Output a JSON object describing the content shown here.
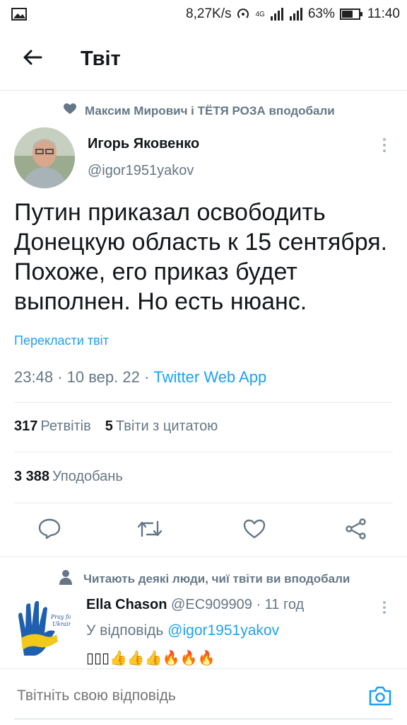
{
  "status_bar": {
    "speed": "8,27K/s",
    "network": "4G",
    "battery": "63%",
    "time": "11:40"
  },
  "header": {
    "title": "Твіт"
  },
  "social_context": "Максим Мирович і ТЁТЯ РОЗА вподобали",
  "tweet": {
    "author_name": "Игорь Яковенко",
    "author_handle": "@igor1951yakov",
    "text": "Путин приказал освободить Донецкую область к 15 сентября. Похоже, его приказ будет выполнен. Но есть нюанс.",
    "translate_label": "Перекласти твіт",
    "time": "23:48",
    "date": "10 вер. 22",
    "source_app": "Twitter Web App",
    "retweets_count": "317",
    "retweets_label": "Ретвітів",
    "quotes_count": "5",
    "quotes_label": "Твіти з цитатою",
    "likes_count": "3 388",
    "likes_label": "Уподобань"
  },
  "reply_context": "Читають деякі люди, чиї твіти ви вподобали",
  "reply": {
    "author_name": "Ella Chason",
    "author_handle": "@EC909909",
    "age": "11 год",
    "reply_to_label": "У відповідь",
    "reply_to_handle": "@igor1951yakov",
    "text": "▯▯▯👍👍👍🔥🔥🔥"
  },
  "composer": {
    "placeholder": "Твітніть свою відповідь"
  },
  "icons": {
    "back": "arrow-left-icon",
    "like": "heart-icon",
    "retweet": "retweet-icon",
    "reply": "reply-icon",
    "share": "share-icon",
    "camera": "camera-icon",
    "person": "person-icon"
  },
  "colors": {
    "accent": "#1da1f2",
    "muted": "#657786",
    "text": "#14171a"
  }
}
